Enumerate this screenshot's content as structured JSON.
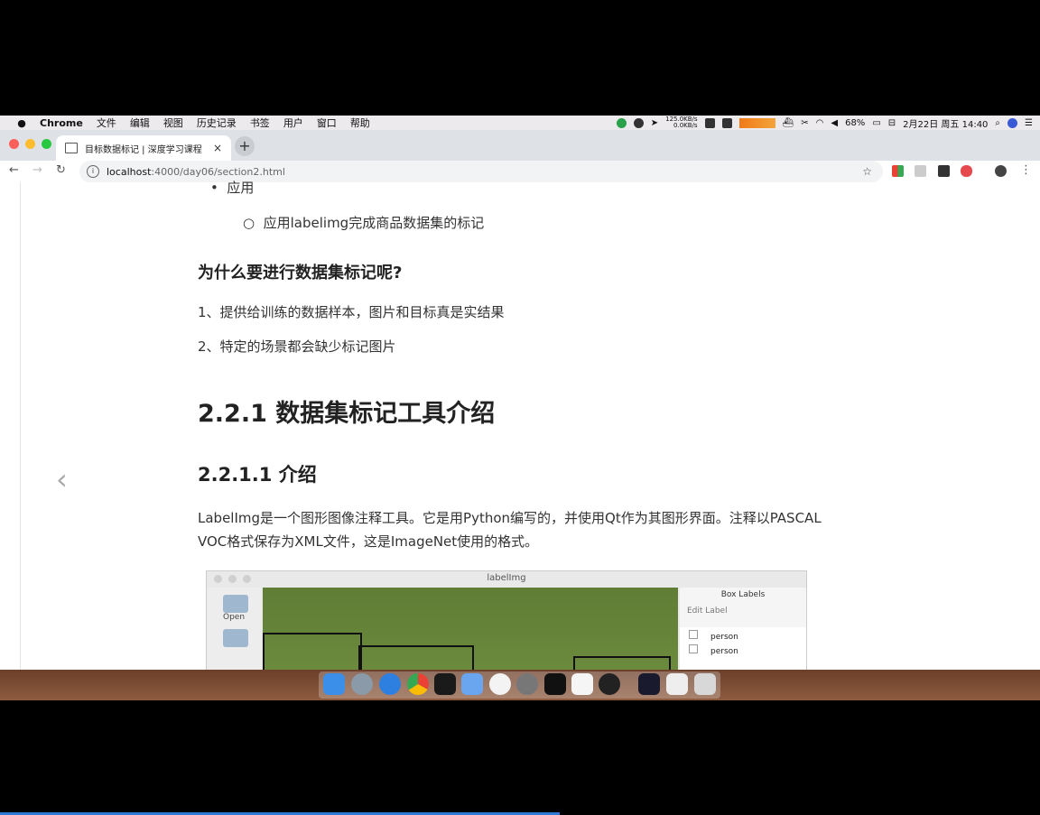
{
  "menubar": {
    "app": "Chrome",
    "items": [
      "文件",
      "编辑",
      "视图",
      "历史记录",
      "书签",
      "用户",
      "窗口",
      "帮助"
    ],
    "net_up": "125.0KB/s",
    "net_down": "0.0KB/s",
    "battery": "68%",
    "datetime": "2月22日 周五 14:40"
  },
  "browser": {
    "tab_title": "目标数据标记 | 深度学习课程",
    "tab_close": "×",
    "new_tab": "+",
    "url_host": "localhost",
    "url_path": ":4000/day06/section2.html"
  },
  "page": {
    "bullet_app": "应用",
    "sub_bullet": "应用labelimg完成商品数据集的标记",
    "why_heading": "为什么要进行数据集标记呢?",
    "reason1": "1、提供给训练的数据样本，图片和目标真是实结果",
    "reason2": "2、特定的场景都会缺少标记图片",
    "h2": "2.2.1 数据集标记工具介绍",
    "h3": "2.2.1.1 介绍",
    "intro_line1": "LabelImg是一个图形图像注释工具。它是用Python编写的，并使用Qt作为其图形界面。注释以PASCAL",
    "intro_line2": "VOC格式保存为XML文件，这是ImageNet使用的格式。",
    "back_arrow": "‹"
  },
  "figure": {
    "title": "labelImg",
    "open_label": "Open",
    "panel_header": "Box Labels",
    "edit_label": "Edit Label",
    "labels": [
      "person",
      "person"
    ]
  }
}
